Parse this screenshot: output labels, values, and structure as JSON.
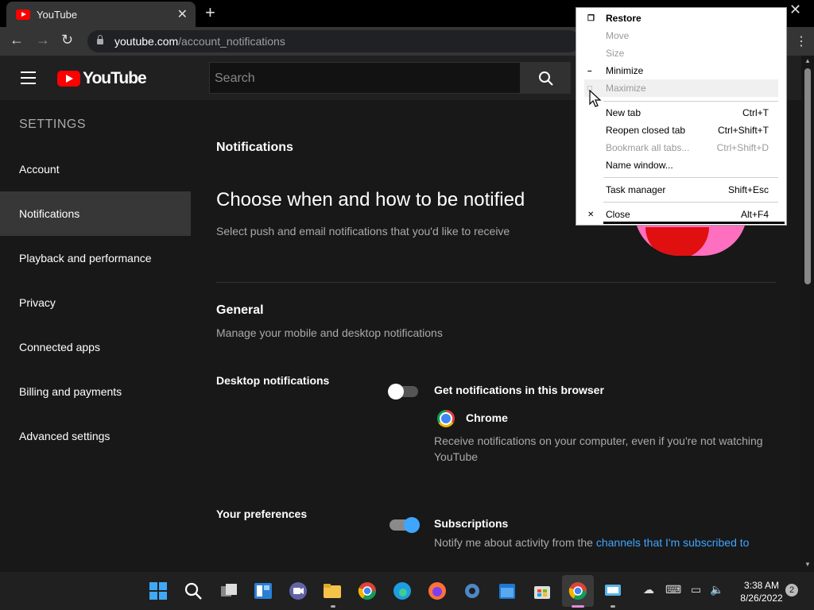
{
  "browser": {
    "tab_title": "YouTube",
    "url_host": "youtube.com",
    "url_path": "/account_notifications"
  },
  "header": {
    "logo_text": "YouTube",
    "search_placeholder": "Search"
  },
  "sidebar": {
    "heading": "SETTINGS",
    "items": [
      {
        "label": "Account"
      },
      {
        "label": "Notifications",
        "active": true
      },
      {
        "label": "Playback and performance"
      },
      {
        "label": "Privacy"
      },
      {
        "label": "Connected apps"
      },
      {
        "label": "Billing and payments"
      },
      {
        "label": "Advanced settings"
      }
    ]
  },
  "main": {
    "section_title": "Notifications",
    "headline": "Choose when and how to be notified",
    "subtitle": "Select push and email notifications that you'd like to receive",
    "general_title": "General",
    "general_sub": "Manage your mobile and desktop notifications",
    "desktop": {
      "label": "Desktop notifications",
      "option_title": "Get notifications in this browser",
      "browser_name": "Chrome",
      "description": "Receive notifications on your computer, even if you're not watching YouTube",
      "enabled": false
    },
    "preferences": {
      "label": "Your preferences",
      "option_title": "Subscriptions",
      "description_prefix": "Notify me about activity from the ",
      "description_link": "channels that I'm subscribed to",
      "enabled": true
    }
  },
  "context_menu": {
    "items": [
      {
        "label": "Restore",
        "mark": "restore-icon",
        "bold": true
      },
      {
        "label": "Move",
        "disabled": true
      },
      {
        "label": "Size",
        "disabled": true
      },
      {
        "label": "Minimize",
        "mark": "minimize-icon"
      },
      {
        "label": "Maximize",
        "mark": "maximize-icon",
        "disabled": true,
        "highlighted": true
      },
      {
        "label": "New tab",
        "shortcut": "Ctrl+T"
      },
      {
        "label": "Reopen closed tab",
        "shortcut": "Ctrl+Shift+T"
      },
      {
        "label": "Bookmark all tabs...",
        "shortcut": "Ctrl+Shift+D",
        "disabled": true
      },
      {
        "label": "Name window..."
      },
      {
        "label": "Task manager",
        "shortcut": "Shift+Esc"
      },
      {
        "label": "Close",
        "shortcut": "Alt+F4",
        "mark": "close-icon"
      }
    ]
  },
  "taskbar": {
    "time": "3:38 AM",
    "date": "8/26/2022",
    "notification_count": "2"
  },
  "colors": {
    "accent": "#3ea6ff",
    "brand_red": "#ff0000",
    "background": "#181818"
  }
}
